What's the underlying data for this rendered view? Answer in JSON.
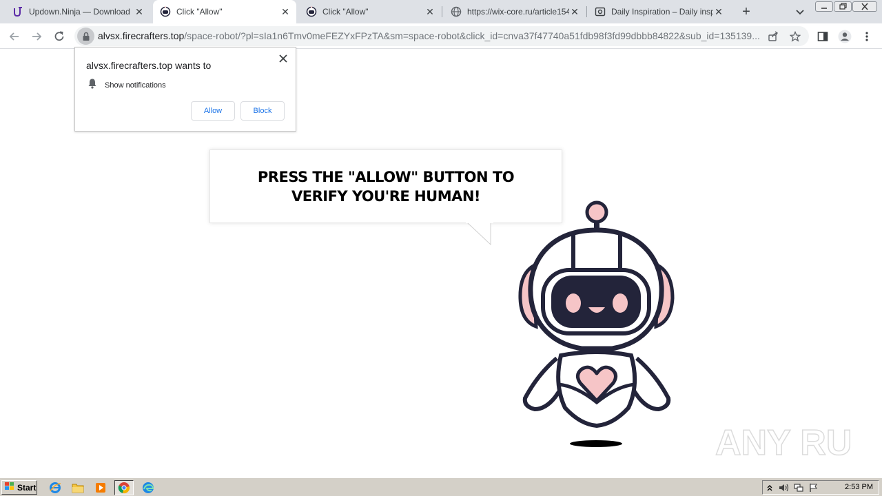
{
  "browser": {
    "tabs": [
      {
        "title": "Updown.Ninja — Download",
        "favicon": "updown-ninja-icon",
        "active": false
      },
      {
        "title": "Click \"Allow\"",
        "favicon": "robot-favicon",
        "active": true
      },
      {
        "title": "Click \"Allow\"",
        "favicon": "robot-favicon",
        "active": false
      },
      {
        "title": "https://wix-core.ru/article154",
        "favicon": "globe-icon",
        "active": false
      },
      {
        "title": "Daily Inspiration – Daily inspira",
        "favicon": "daily-inspiration-icon",
        "active": false
      }
    ],
    "new_tab_symbol": "+",
    "address": {
      "host": "alvsx.firecrafters.top",
      "path": "/space-robot/?pl=sIa1n6Tmv0meFEZYxFPzTA&sm=space-robot&click_id=cnva37f47740a51fdb98f3fd99dbbb84822&sub_id=135139..."
    }
  },
  "permission_prompt": {
    "origin_line": "alvsx.firecrafters.top wants to",
    "permission": "Show notifications",
    "allow_label": "Allow",
    "block_label": "Block"
  },
  "page": {
    "message": "PRESS THE \"ALLOW\" BUTTON TO VERIFY YOU'RE HUMAN!"
  },
  "watermark": {
    "text": "ANY RUN"
  },
  "taskbar": {
    "start_label": "Start",
    "apps": [
      "internet-explorer-icon",
      "file-explorer-icon",
      "media-player-icon",
      "chrome-icon",
      "edge-icon"
    ],
    "clock": "2:53 PM"
  },
  "colors": {
    "tab_strip": "#dee1e6",
    "accent_blue": "#1a73e8",
    "robot_navy": "#23243a",
    "robot_pink": "#f6c5c7",
    "taskbar": "#d4d0c8"
  }
}
